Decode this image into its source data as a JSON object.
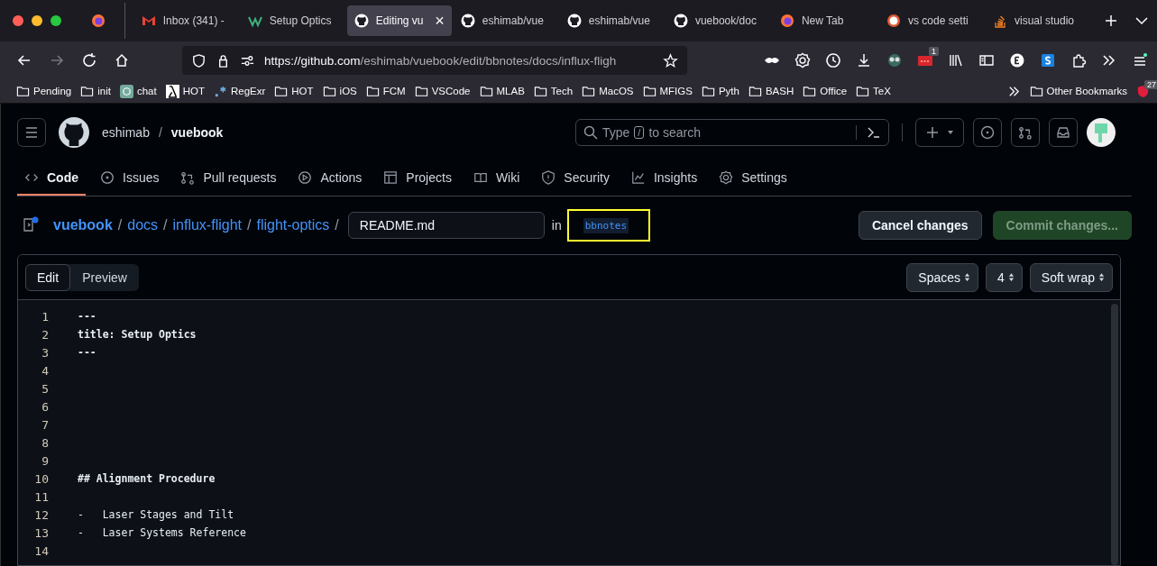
{
  "browser": {
    "tabs": [
      {
        "kind": "firefox",
        "selected": false
      },
      {
        "kind": "gmail",
        "title": "Inbox (341) -",
        "selected": false
      },
      {
        "kind": "vuepress",
        "title": "Setup Optics",
        "selected": false
      },
      {
        "kind": "github",
        "title": "Editing vu",
        "close": "×",
        "selected": true
      },
      {
        "kind": "github",
        "title": "eshimab/vue",
        "selected": false
      },
      {
        "kind": "github",
        "title": "eshimab/vue",
        "selected": false
      },
      {
        "kind": "github",
        "title": "vuebook/doc",
        "selected": false
      },
      {
        "kind": "firefox",
        "title": "New Tab",
        "selected": false
      },
      {
        "kind": "duck",
        "title": "vs code setti",
        "selected": false
      },
      {
        "kind": "stack",
        "title": "visual studio",
        "selected": false
      }
    ],
    "url_host": "https://github.com",
    "url_path": "/eshimab/vuebook/edit/bbnotes/docs/influx-fligh",
    "extension_badge": "1",
    "bookmarks_badge": "27",
    "bookmarks": [
      {
        "kind": "folder",
        "label": "Pending"
      },
      {
        "kind": "folder",
        "label": "init"
      },
      {
        "kind": "chat",
        "label": "chat"
      },
      {
        "kind": "site",
        "label": "HOT"
      },
      {
        "kind": "regex",
        "label": "RegExr"
      },
      {
        "kind": "folder",
        "label": "HOT"
      },
      {
        "kind": "folder",
        "label": "iOS"
      },
      {
        "kind": "folder",
        "label": "FCM"
      },
      {
        "kind": "folder",
        "label": "VSCode"
      },
      {
        "kind": "folder",
        "label": "MLAB"
      },
      {
        "kind": "folder",
        "label": "Tech"
      },
      {
        "kind": "folder",
        "label": "MacOS"
      },
      {
        "kind": "folder",
        "label": "MFIGS"
      },
      {
        "kind": "folder",
        "label": "Pyth"
      },
      {
        "kind": "folder",
        "label": "BASH"
      },
      {
        "kind": "folder",
        "label": "Office"
      },
      {
        "kind": "folder",
        "label": "TeX"
      }
    ],
    "other_bookmarks": "Other Bookmarks"
  },
  "github": {
    "owner": "eshimab",
    "separator": "/",
    "repo": "vuebook",
    "search_prefix": "Type",
    "search_key": "/",
    "search_suffix": "to search",
    "nav": [
      {
        "label": "Code",
        "selected": true
      },
      {
        "label": "Issues",
        "selected": false
      },
      {
        "label": "Pull requests",
        "selected": false
      },
      {
        "label": "Actions",
        "selected": false
      },
      {
        "label": "Projects",
        "selected": false
      },
      {
        "label": "Wiki",
        "selected": false
      },
      {
        "label": "Security",
        "selected": false
      },
      {
        "label": "Insights",
        "selected": false
      },
      {
        "label": "Settings",
        "selected": false
      }
    ]
  },
  "editor": {
    "breadcrumb": [
      "vuebook",
      "docs",
      "influx-flight",
      "flight-optics"
    ],
    "path_separator": "/",
    "filename": "README.md",
    "in_label": "in",
    "branch": "bbnotes",
    "cancel": "Cancel changes",
    "commit": "Commit changes...",
    "modes": [
      {
        "label": "Edit",
        "selected": true
      },
      {
        "label": "Preview",
        "selected": false
      }
    ],
    "indent_mode": "Spaces",
    "indent_size": "4",
    "wrap_mode": "Soft wrap",
    "lines": [
      {
        "number": "1",
        "text": "---",
        "bold": true
      },
      {
        "number": "2",
        "text": "title: Setup Optics",
        "bold": true
      },
      {
        "number": "3",
        "text": "---",
        "bold": true
      },
      {
        "number": "4"
      },
      {
        "number": "5"
      },
      {
        "number": "6"
      },
      {
        "number": "7"
      },
      {
        "number": "8"
      },
      {
        "number": "9"
      },
      {
        "number": "10",
        "text": "## Alignment Procedure",
        "bold": true
      },
      {
        "number": "11"
      },
      {
        "number": "12",
        "text": "-   Laser Stages and Tilt",
        "bold": false
      },
      {
        "number": "13",
        "text": "-   Laser Systems Reference",
        "bold": false
      },
      {
        "number": "14"
      }
    ]
  }
}
